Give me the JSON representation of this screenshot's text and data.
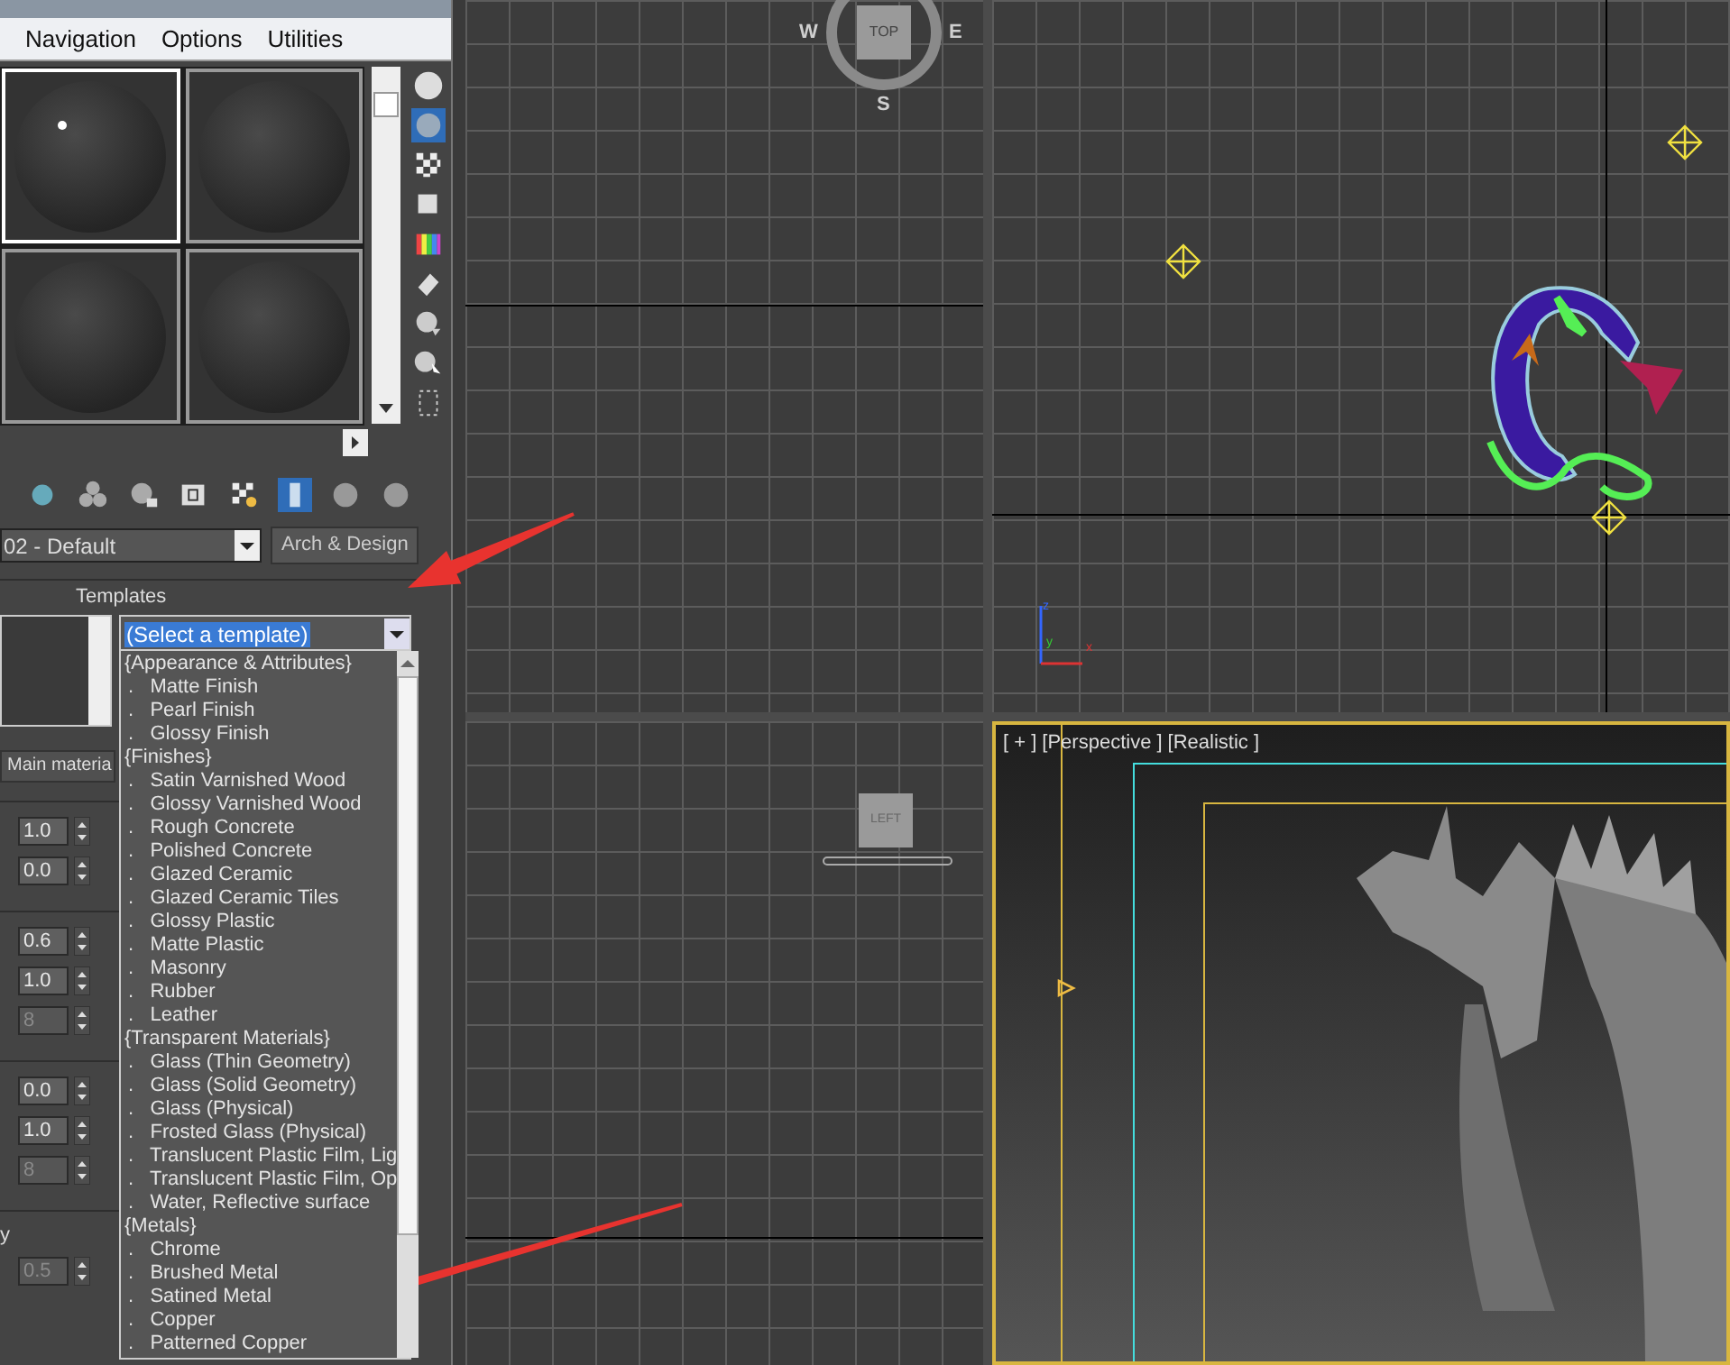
{
  "material_editor": {
    "menu": [
      "Navigation",
      "Options",
      "Utilities"
    ],
    "sample_slots": [
      {
        "selected": true
      },
      {
        "selected": false
      },
      {
        "selected": false
      },
      {
        "selected": false
      }
    ],
    "material_name": "02 - Default",
    "material_type": "Arch & Design",
    "templates": {
      "title": "Templates",
      "combo": "(Select a template)",
      "items": [
        {
          "kind": "group",
          "text": "{Appearance & Attributes}"
        },
        {
          "kind": "option",
          "text": ".   Matte Finish"
        },
        {
          "kind": "option",
          "text": ".   Pearl Finish"
        },
        {
          "kind": "option",
          "text": ".   Glossy Finish"
        },
        {
          "kind": "group",
          "text": "{Finishes}"
        },
        {
          "kind": "option",
          "text": ".   Satin Varnished Wood"
        },
        {
          "kind": "option",
          "text": ".   Glossy Varnished Wood"
        },
        {
          "kind": "option",
          "text": ".   Rough Concrete"
        },
        {
          "kind": "option",
          "text": ".   Polished Concrete"
        },
        {
          "kind": "option",
          "text": ".   Glazed Ceramic"
        },
        {
          "kind": "option",
          "text": ".   Glazed Ceramic Tiles"
        },
        {
          "kind": "option",
          "text": ".   Glossy Plastic"
        },
        {
          "kind": "option",
          "text": ".   Matte Plastic"
        },
        {
          "kind": "option",
          "text": ".   Masonry"
        },
        {
          "kind": "option",
          "text": ".   Rubber"
        },
        {
          "kind": "option",
          "text": ".   Leather"
        },
        {
          "kind": "group",
          "text": "{Transparent Materials}"
        },
        {
          "kind": "option",
          "text": ".   Glass (Thin Geometry)"
        },
        {
          "kind": "option",
          "text": ".   Glass (Solid Geometry)"
        },
        {
          "kind": "option",
          "text": ".   Glass (Physical)"
        },
        {
          "kind": "option",
          "text": ".   Frosted Glass (Physical)"
        },
        {
          "kind": "option",
          "text": ".   Translucent Plastic Film, Lig"
        },
        {
          "kind": "option",
          "text": ".   Translucent Plastic Film, Op"
        },
        {
          "kind": "option",
          "text": ".   Water, Reflective surface"
        },
        {
          "kind": "group",
          "text": "{Metals}"
        },
        {
          "kind": "option",
          "text": ".   Chrome"
        },
        {
          "kind": "option",
          "text": ".   Brushed Metal"
        },
        {
          "kind": "option",
          "text": ".   Satined Metal"
        },
        {
          "kind": "option",
          "text": ".   Copper"
        },
        {
          "kind": "option",
          "text": ".   Patterned Copper"
        }
      ]
    },
    "tab": "Main materia",
    "spinner_groups": [
      {
        "spinners": [
          {
            "value": "1.0",
            "disabled": false
          },
          {
            "value": "0.0",
            "disabled": false
          }
        ]
      },
      {
        "spinners": [
          {
            "value": "0.6",
            "disabled": false
          },
          {
            "value": "1.0",
            "disabled": false
          },
          {
            "value": "8",
            "disabled": true
          }
        ]
      },
      {
        "spinners": [
          {
            "value": "0.0",
            "disabled": false
          },
          {
            "value": "1.0",
            "disabled": false
          },
          {
            "value": "8",
            "disabled": true
          }
        ]
      },
      {
        "label": "y",
        "spinners": [
          {
            "value": "0.5",
            "disabled": true
          }
        ]
      }
    ]
  },
  "viewports": {
    "top": {
      "compass": {
        "west": "W",
        "east": "E",
        "south": "S",
        "cube": "TOP"
      }
    },
    "front": {
      "axes": {
        "z": "z",
        "y": "y",
        "x": "x"
      }
    },
    "left": {
      "cube": "LEFT"
    },
    "perspective": {
      "labels": [
        "[ + ]",
        "[Perspective ]",
        "[Realistic ]"
      ]
    }
  }
}
